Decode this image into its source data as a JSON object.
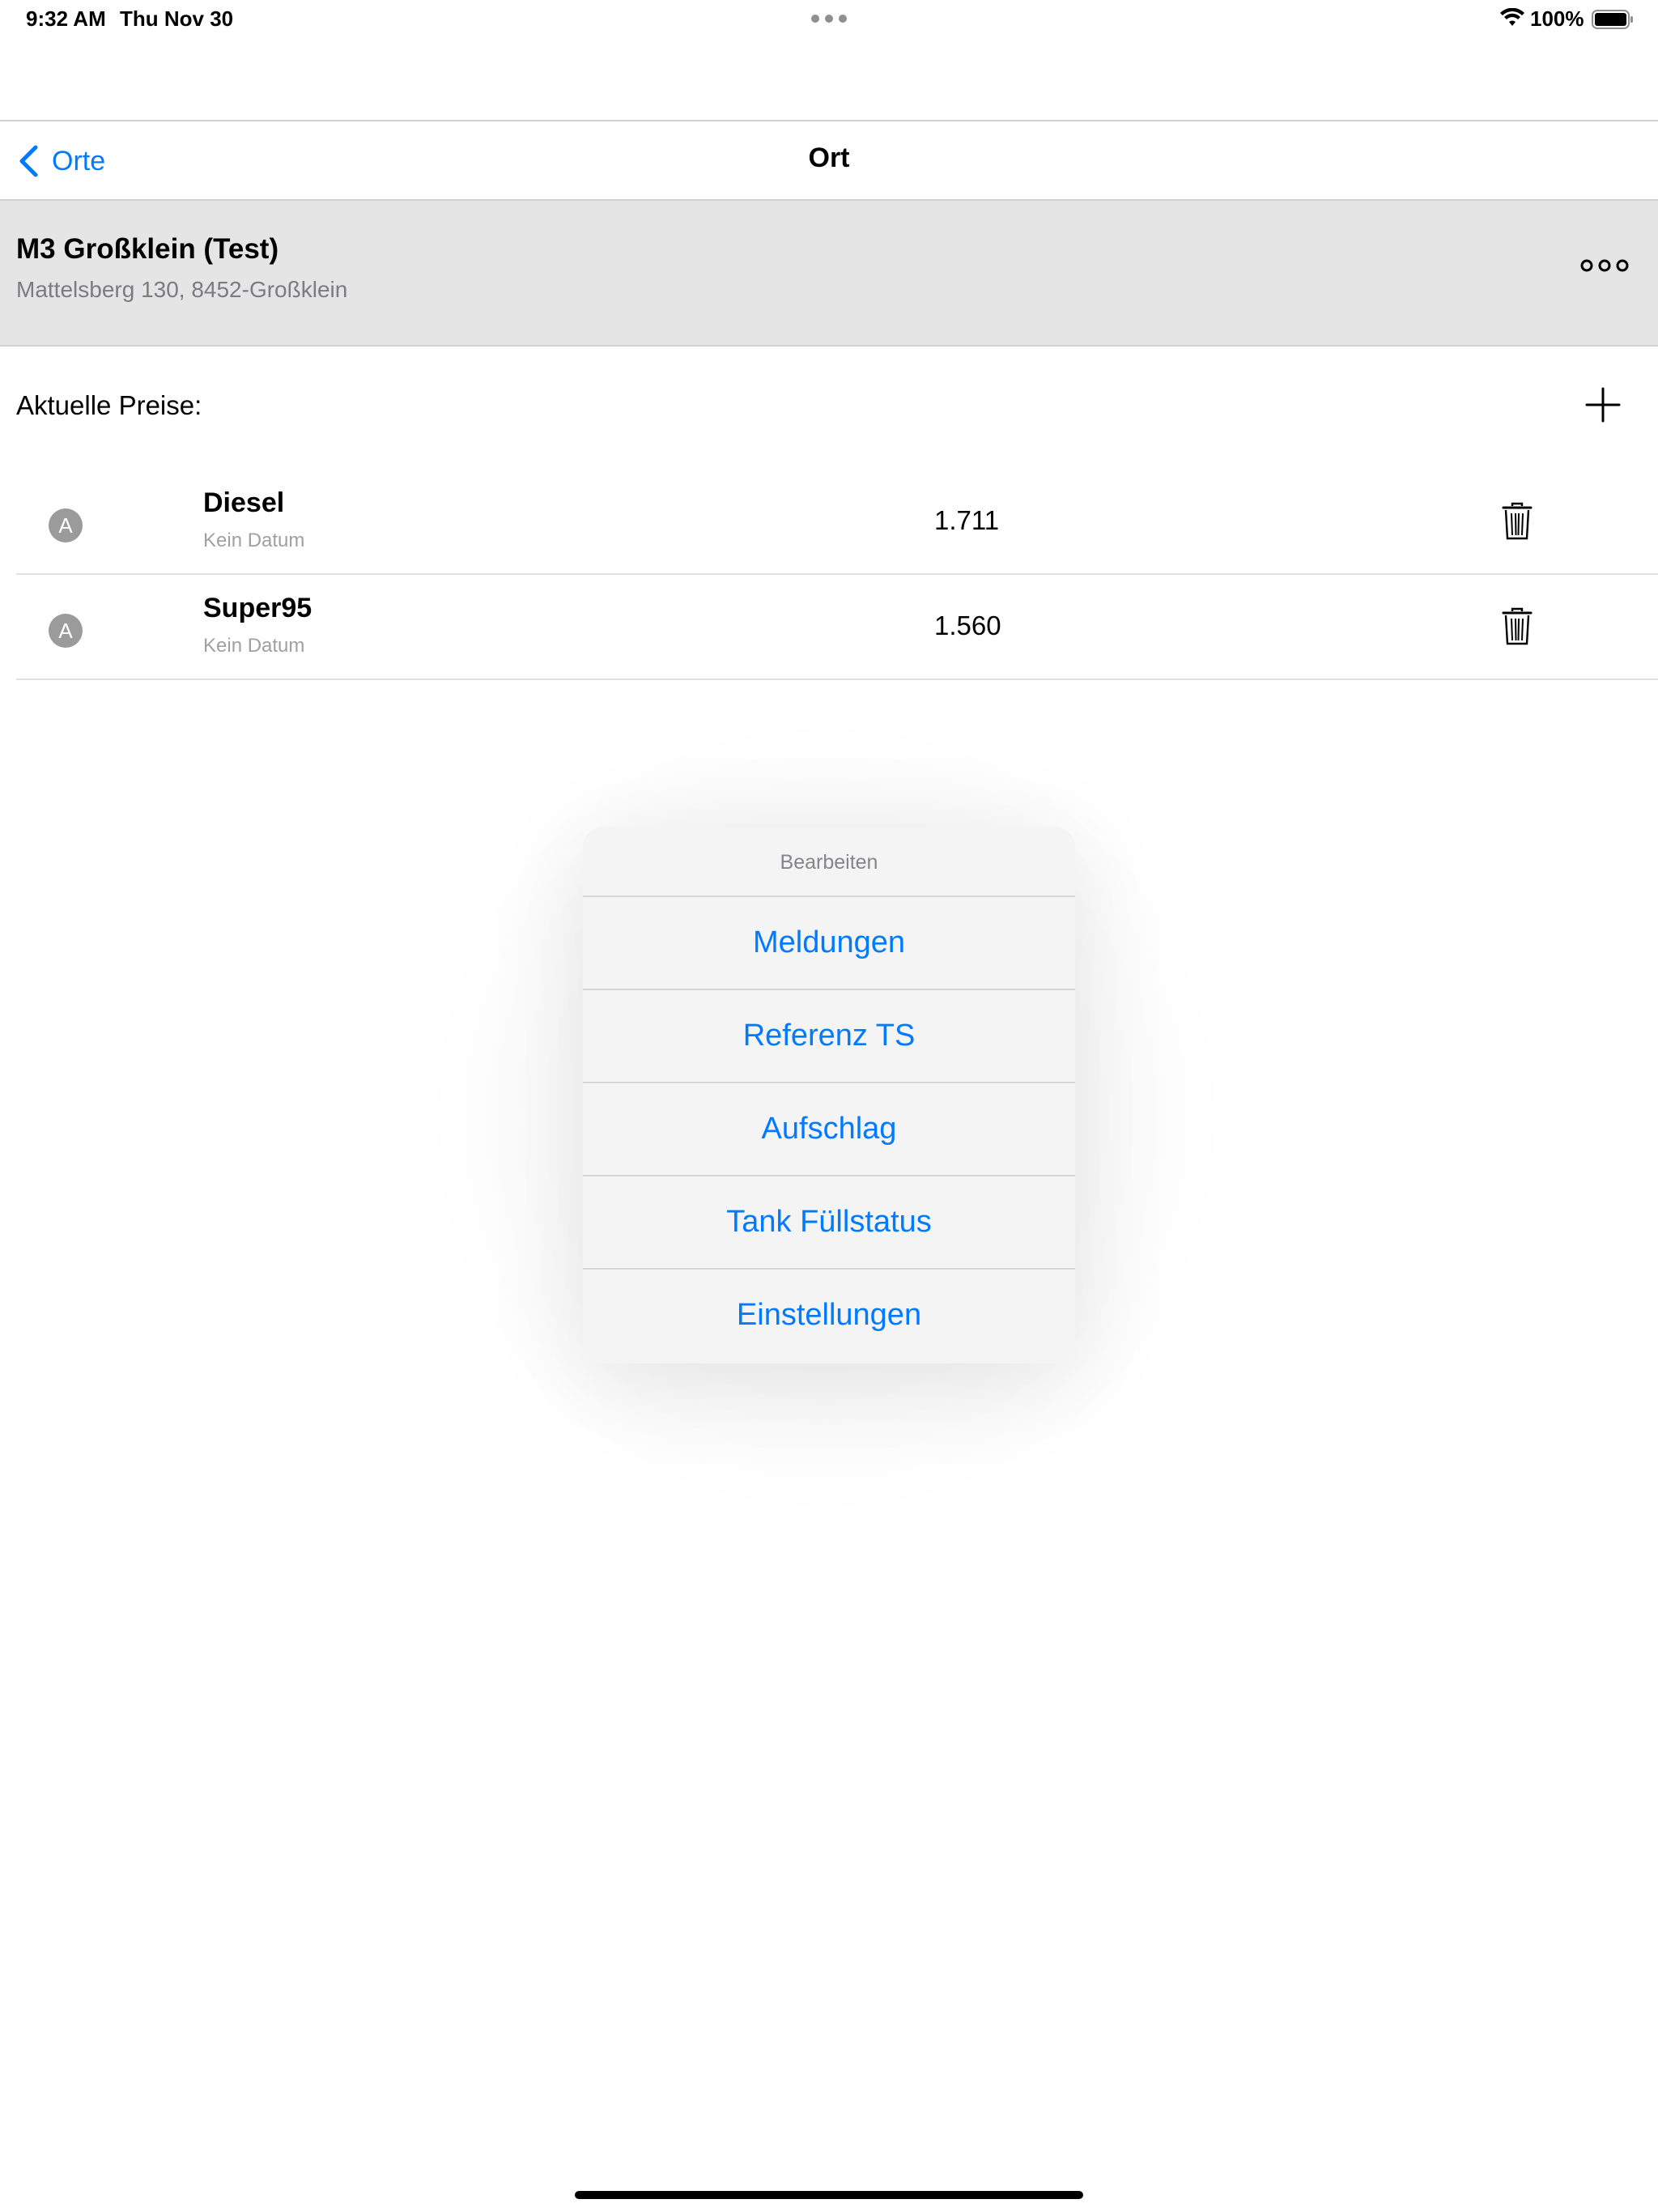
{
  "status_bar": {
    "time": "9:32 AM",
    "date": "Thu Nov 30",
    "battery_percent": "100%",
    "wifi_icon": "wifi-icon",
    "battery_icon": "battery-icon"
  },
  "nav": {
    "back_label": "Orte",
    "title": "Ort",
    "back_icon": "chevron-left-icon"
  },
  "location": {
    "name": "M3 Großklein (Test)",
    "address": "Mattelsberg 130, 8452-Großklein",
    "more_icon": "more-icon"
  },
  "prices_section": {
    "title": "Aktuelle Preise:",
    "add_icon": "plus-icon",
    "items": [
      {
        "badge": "A",
        "name": "Diesel",
        "date": "Kein Datum",
        "value": "1.711"
      },
      {
        "badge": "A",
        "name": "Super95",
        "date": "Kein Datum",
        "value": "1.560"
      }
    ]
  },
  "popover": {
    "title": "Bearbeiten",
    "items": [
      {
        "label": "Meldungen"
      },
      {
        "label": "Referenz TS"
      },
      {
        "label": "Aufschlag"
      },
      {
        "label": "Tank Füllstatus"
      },
      {
        "label": "Einstellungen"
      }
    ]
  },
  "colors": {
    "accent": "#007aff",
    "header_bg": "#e5e5e5",
    "popover_bg": "#f4f4f4"
  }
}
